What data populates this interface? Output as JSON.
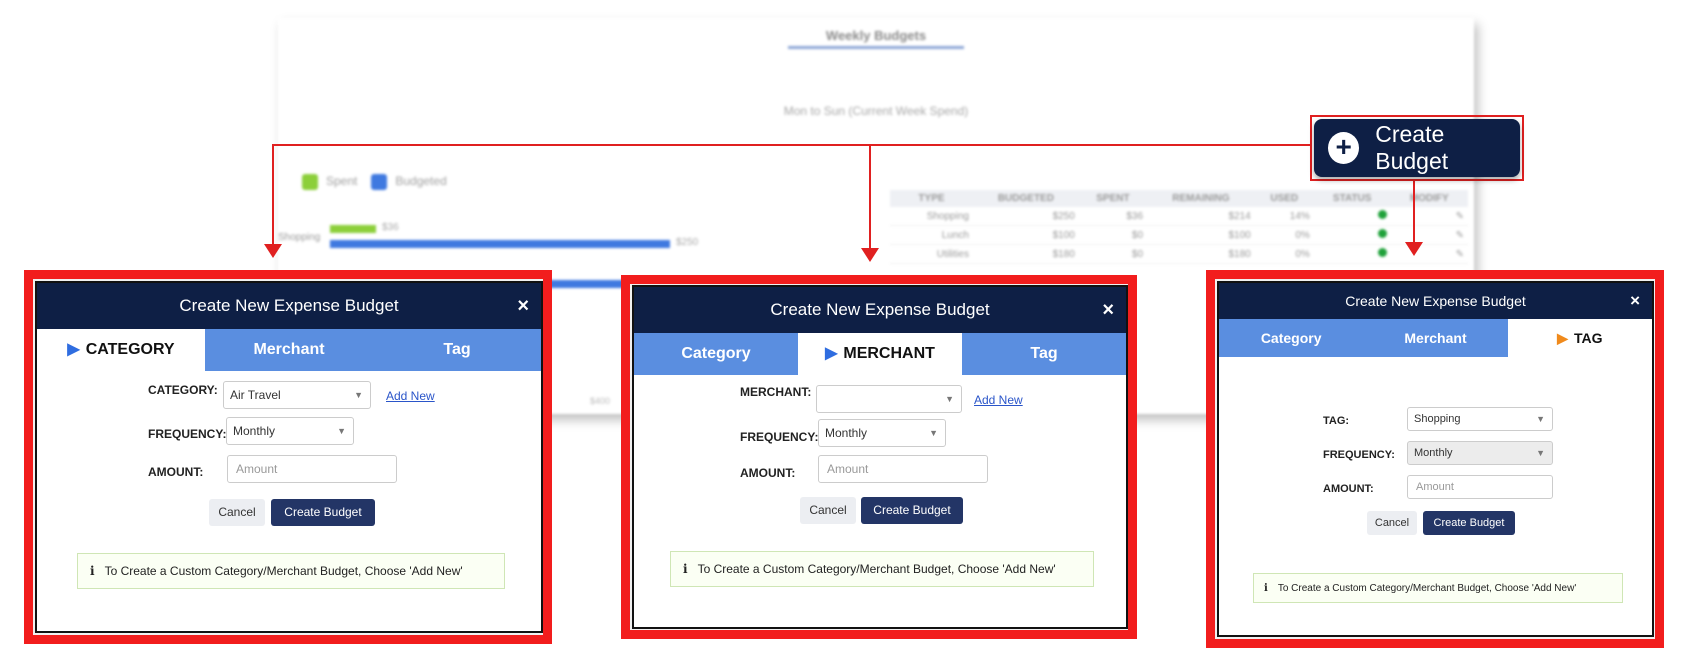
{
  "background": {
    "title": "Weekly Budgets",
    "subtitle": "Mon to Sun (Current Week Spend)",
    "legend": [
      {
        "label": "Spent",
        "color": "#8ccf3a"
      },
      {
        "label": "Budgeted",
        "color": "#3f79e0"
      }
    ],
    "bar_label": "Shopping",
    "bar_spent_value": "$36",
    "bar_budget_value": "$250",
    "axis_tick": "$400",
    "table": {
      "headers": [
        "TYPE",
        "BUDGETED",
        "SPENT",
        "REMAINING",
        "USED",
        "STATUS",
        "MODIFY"
      ],
      "rows": [
        [
          "Shopping",
          "$250",
          "$36",
          "$214",
          "14%"
        ],
        [
          "Lunch",
          "$100",
          "$0",
          "$100",
          "0%"
        ],
        [
          "Utilities",
          "$180",
          "$0",
          "$180",
          "0%"
        ]
      ]
    }
  },
  "create_budget_button": {
    "label": "Create Budget",
    "icon": "plus-circle-icon"
  },
  "modals": [
    {
      "title": "Create New Expense Budget",
      "close": "×",
      "tabs": [
        "CATEGORY",
        "Merchant",
        "Tag"
      ],
      "active_tab": 0,
      "field1_label": "CATEGORY:",
      "field1_value": "Air Travel",
      "add_new": "Add New",
      "frequency_label": "FREQUENCY:",
      "frequency_value": "Monthly",
      "amount_label": "AMOUNT:",
      "amount_placeholder": "Amount",
      "cancel": "Cancel",
      "create": "Create Budget",
      "info": "To Create a Custom Category/Merchant Budget, Choose 'Add New'"
    },
    {
      "title": "Create New Expense Budget",
      "close": "×",
      "tabs": [
        "Category",
        "MERCHANT",
        "Tag"
      ],
      "active_tab": 1,
      "field1_label": "MERCHANT:",
      "field1_value": "",
      "add_new": "Add New",
      "frequency_label": "FREQUENCY:",
      "frequency_value": "Monthly",
      "amount_label": "AMOUNT:",
      "amount_placeholder": "Amount",
      "cancel": "Cancel",
      "create": "Create Budget",
      "info": "To Create a Custom Category/Merchant Budget, Choose 'Add New'"
    },
    {
      "title": "Create New Expense Budget",
      "close": "×",
      "tabs": [
        "Category",
        "Merchant",
        "TAG"
      ],
      "active_tab": 2,
      "field1_label": "TAG:",
      "field1_value": "Shopping",
      "frequency_label": "FREQUENCY:",
      "frequency_value": "Monthly",
      "amount_label": "AMOUNT:",
      "amount_placeholder": "Amount",
      "cancel": "Cancel",
      "create": "Create Budget",
      "info": "To Create a Custom Category/Merchant Budget, Choose 'Add New'"
    }
  ],
  "colors": {
    "navy": "#0e1f45",
    "tab_blue": "#5a8ee0",
    "highlight_red": "#f21d1d",
    "tag_triangle": "#f08a1c"
  }
}
